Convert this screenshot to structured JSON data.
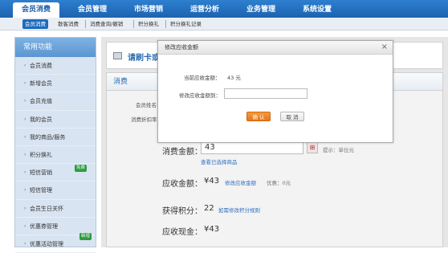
{
  "topnav": {
    "items": [
      "会员消费",
      "会员管理",
      "市场营销",
      "运营分析",
      "业务管理",
      "系统设置"
    ]
  },
  "subnav": {
    "items": [
      "会员消费",
      "散客消费",
      "消费查询/撤销",
      "积分换礼",
      "积分换礼记录"
    ]
  },
  "sidebar": {
    "title": "常用功能",
    "items": [
      "会员消费",
      "新增会员",
      "会员充值",
      "我的会员",
      "我的商品/服务",
      "积分换礼",
      "短信营销",
      "短信管理",
      "会员生日关怀",
      "优惠券管理",
      "优惠活动管理"
    ],
    "badge_sms": "免费",
    "badge_promo": "新增"
  },
  "content": {
    "title": "请刷卡或",
    "panel_title": "消费",
    "member_name_label": "会员姓名:",
    "discount_label": "消费折扣率:",
    "amount_label": "消费金额：",
    "amount_value": "43",
    "amount_hint": "提示：单位元",
    "view_selected_link": "查看已选择商品",
    "receivable_label": "应收金额：",
    "receivable_value": "¥43",
    "modify_receivable_link": "修改应收金额",
    "discount_text": "优惠：0元",
    "points_label": "获得积分：",
    "points_value": "22",
    "points_rule_link": "如需修改积分规则",
    "cash_label": "应收现金：",
    "cash_value": "¥43"
  },
  "modal": {
    "title": "修改应收金额",
    "close_symbol": "×",
    "current_label": "当前应收金额：",
    "current_value": "43 元",
    "modify_label": "修改应收金额到：",
    "input_value": "",
    "ok_label": "确 认",
    "cancel_label": "取 消"
  },
  "colors": {
    "accent": "#1b6bbd",
    "ok_button": "#e5751a",
    "badge": "#2f9a43"
  }
}
